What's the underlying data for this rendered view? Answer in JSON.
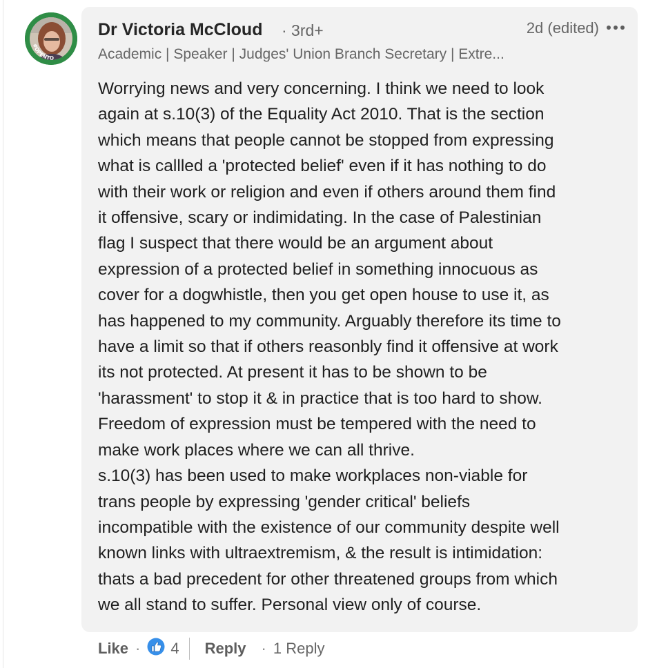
{
  "avatar": {
    "badge_text": "#OPENTOWORK",
    "badge_color": "#2f8d46"
  },
  "comment": {
    "author_name": "Dr Victoria McCloud",
    "degree": "· 3rd+",
    "timestamp": "2d (edited)",
    "headline": "Academic | Speaker | Judges' Union Branch Secretary | Extre...",
    "body_lines": [
      "Worrying news and very concerning. I think we need to look",
      "again at s.10(3) of the Equality Act 2010. That is the section",
      "which means that people cannot be stopped from expressing",
      "what is callled a 'protected belief' even if it has nothing to do",
      "with their work or religion and even if others around them find",
      "it offensive, scary or indimidating. In the case of Palestinian",
      "flag I suspect that there would be an argument about",
      "expression of a protected belief in something innocuous as",
      "cover for a dogwhistle, then you get open house to use it, as",
      "has happened to my community. Arguably therefore its time to",
      "have a limit so that if others reasonbly find it offensive at work",
      "its not protected. At present it has to be shown to be",
      "'harassment' to stop it & in practice that is too hard to show.",
      "Freedom of expression must be tempered with the need to",
      "make work places where we can all thrive.",
      "s.10(3) has been used to make workplaces non-viable for",
      "trans people by expressing 'gender critical' beliefs",
      "incompatible with the existence of our community despite well",
      "known links with ultraextremism, & the result is intimidation:",
      "thats a bad precedent for other threatened groups from which",
      "we all stand to suffer. Personal view only of course."
    ]
  },
  "actions": {
    "like_label": "Like",
    "separator": "·",
    "reaction_icon": "thumbs-up-icon",
    "reaction_count": "4",
    "reply_label": "Reply",
    "reply_count": "1 Reply"
  },
  "colors": {
    "card_background": "#f2f2f2",
    "like_blue": "#378fe9"
  }
}
